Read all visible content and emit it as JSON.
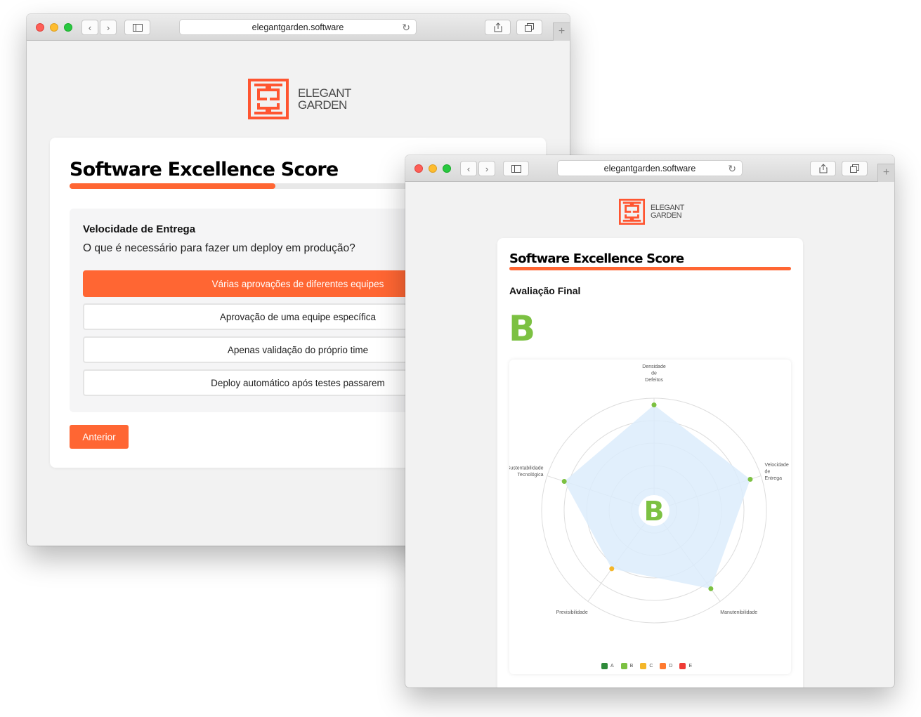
{
  "browser": {
    "url": "elegantgarden.software"
  },
  "brand": {
    "line1": "ELEGANT",
    "line2": "GARDEN",
    "color": "#ff5531"
  },
  "quiz": {
    "title": "Software Excellence Score",
    "progress": 0.45,
    "section": "Velocidade de Entrega",
    "question": "O que é necessário para fazer um deploy em produção?",
    "options": [
      {
        "label": "Várias aprovações de diferentes equipes",
        "selected": true
      },
      {
        "label": "Aprovação de uma equipe específica",
        "selected": false
      },
      {
        "label": "Apenas validação do próprio time",
        "selected": false
      },
      {
        "label": "Deploy automático após testes passarem",
        "selected": false
      }
    ],
    "prev_label": "Anterior"
  },
  "result": {
    "title": "Software Excellence Score",
    "progress": 1.0,
    "subtitle": "Avaliação Final",
    "grade": "B",
    "grade_color": "#7cc142"
  },
  "chart_data": {
    "type": "radar",
    "center_label": "B",
    "axes": [
      {
        "label": "Densidade de Defeitos",
        "value": 4.7,
        "grade": "B"
      },
      {
        "label": "Velocidade de Entrega",
        "value": 4.5,
        "grade": "B"
      },
      {
        "label": "Manutenibilidade",
        "value": 4.3,
        "grade": "B"
      },
      {
        "label": "Previsibilidade",
        "value": 3.2,
        "grade": "C"
      },
      {
        "label": "Sustentabilidade Tecnológica",
        "value": 4.2,
        "grade": "B"
      }
    ],
    "max": 5,
    "rings": 5,
    "fill_color": "#dcecfb",
    "legend": [
      {
        "label": "A",
        "color": "#2e8b3a"
      },
      {
        "label": "B",
        "color": "#7cc142"
      },
      {
        "label": "C",
        "color": "#f4b629"
      },
      {
        "label": "D",
        "color": "#ff7a2f"
      },
      {
        "label": "E",
        "color": "#ef3b35"
      }
    ],
    "legend_position": "bottom"
  }
}
